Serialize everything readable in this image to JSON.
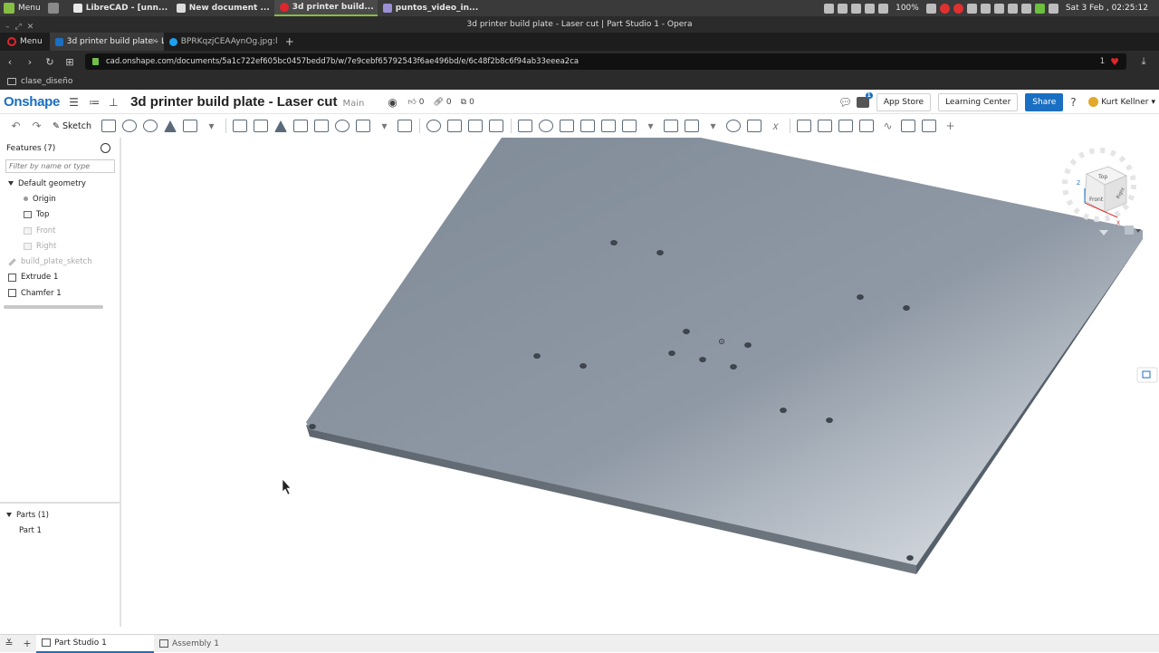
{
  "os_panel": {
    "menu_label": "Menu",
    "tasks": [
      {
        "label": "LibreCAD - [unn...",
        "color": "#e8e8e8"
      },
      {
        "label": "New document ...",
        "color": "#dddddd"
      },
      {
        "label": "3d printer build...",
        "color": "#e0262b"
      },
      {
        "label": "puntos_video_in...",
        "color": "#9b8fd6"
      }
    ],
    "battery": "100%",
    "clock": "Sat  3 Feb , 02:25:12"
  },
  "browser": {
    "window_title": "3d printer build plate - Laser cut | Part Studio 1 - Opera",
    "menu_label": "Menu",
    "tabs": [
      {
        "label": "3d printer build plate - La",
        "favicon": "On"
      },
      {
        "label": "BPRKqzjCEAAynOg.jpg:la",
        "favicon": "twitter-bird"
      }
    ],
    "url": "cad.onshape.com/documents/5a1c722ef605bc0457bedd7b/w/7e9cebf65792543f6ae496bd/e/6c48f2b8c6f94ab33eeea2ca",
    "badge_count": "1",
    "bookmark": "clase_diseño"
  },
  "onshape": {
    "logo": "Onshape",
    "document_title": "3d printer build plate - Laser cut",
    "branch": "Main",
    "likes": "0",
    "links": "0",
    "copies": "0",
    "notification_count": "1",
    "app_store": "App Store",
    "learning_center": "Learning Center",
    "share": "Share",
    "user": "Kurt Kellner"
  },
  "toolbar": {
    "sketch_label": "Sketch"
  },
  "feature_panel": {
    "header": "Features (7)",
    "filter_placeholder": "Filter by name or type",
    "tree": {
      "default_geometry": "Default geometry",
      "origin": "Origin",
      "top": "Top",
      "front": "Front",
      "right": "Right",
      "sketch": "build_plate_sketch",
      "extrude": "Extrude 1",
      "chamfer": "Chamfer 1"
    },
    "parts_header": "Parts (1)",
    "part": "Part 1"
  },
  "viewcube": {
    "top": "Top",
    "front": "Front",
    "right": "Right",
    "axis_x": "X",
    "axis_z": "Z"
  },
  "bottom_tabs": {
    "part_studio": "Part Studio 1",
    "assembly": "Assembly 1"
  },
  "colors": {
    "plate_top": "#8a95a2",
    "plate_side": "#5e666f",
    "onshape_blue": "#1a6fc2"
  }
}
